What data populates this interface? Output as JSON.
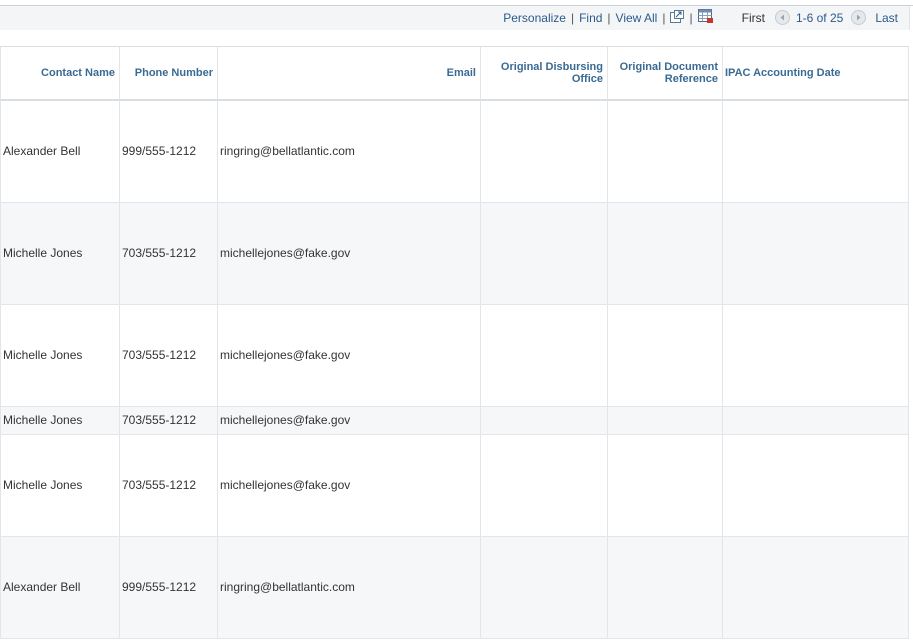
{
  "toolbar": {
    "personalize": "Personalize",
    "find": "Find",
    "view_all": "View All",
    "separator": "|",
    "first": "First",
    "range": "1-6 of 25",
    "last": "Last"
  },
  "columns": [
    "Contact Name",
    "Phone Number",
    "Email",
    "Original Disbursing Office",
    "Original Document Reference",
    "IPAC Accounting Date"
  ],
  "rows": [
    {
      "name": "Alexander Bell",
      "phone": "999/555-1212",
      "email": "ringring@bellatlantic.com",
      "office": "",
      "reference": "",
      "date": ""
    },
    {
      "name": "Michelle Jones",
      "phone": "703/555-1212",
      "email": "michellejones@fake.gov",
      "office": "",
      "reference": "",
      "date": ""
    },
    {
      "name": "Michelle Jones",
      "phone": "703/555-1212",
      "email": "michellejones@fake.gov",
      "office": "",
      "reference": "",
      "date": ""
    },
    {
      "name": "Michelle Jones",
      "phone": "703/555-1212",
      "email": "michellejones@fake.gov",
      "office": "",
      "reference": "",
      "date": ""
    },
    {
      "name": "Michelle Jones",
      "phone": "703/555-1212",
      "email": "michellejones@fake.gov",
      "office": "",
      "reference": "",
      "date": ""
    },
    {
      "name": "Alexander Bell",
      "phone": "999/555-1212",
      "email": "ringring@bellatlantic.com",
      "office": "",
      "reference": "",
      "date": ""
    }
  ],
  "icons": {
    "zoom": "new-window-icon",
    "download": "download-spreadsheet-icon",
    "prev": "previous-arrow-icon",
    "next": "next-arrow-icon"
  },
  "colors": {
    "link": "#2c5a8c",
    "header_text": "#3a6a92",
    "toolbar_bg": "#f3f5f7"
  }
}
